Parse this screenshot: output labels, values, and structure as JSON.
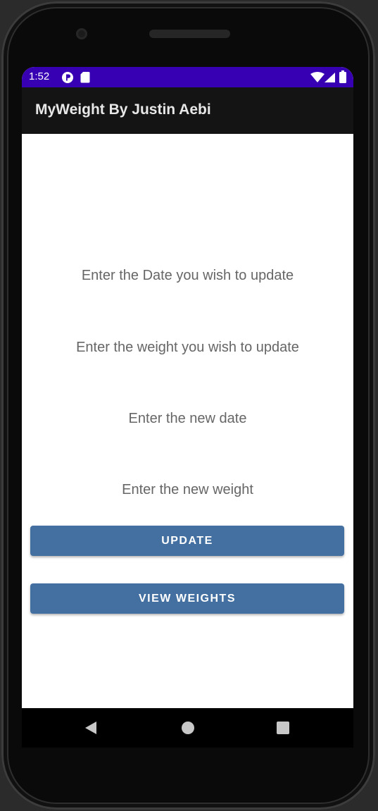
{
  "status_bar": {
    "time": "1:52",
    "icons": [
      "notification-p-icon",
      "sd-card-icon",
      "wifi-icon",
      "signal-icon",
      "battery-icon"
    ],
    "background": "#3700b3"
  },
  "app_bar": {
    "title": "MyWeight By Justin Aebi",
    "background": "#141414"
  },
  "form": {
    "date_to_update_hint": "Enter the Date you wish to update",
    "weight_to_update_hint": "Enter the weight you wish to update",
    "new_date_hint": "Enter the new date",
    "new_weight_hint": "Enter the new weight"
  },
  "buttons": {
    "update_label": "UPDATE",
    "view_weights_label": "VIEW WEIGHTS",
    "color": "#4470a1"
  },
  "nav_bar": {
    "icons": [
      "back-icon",
      "home-icon",
      "recents-icon"
    ]
  }
}
